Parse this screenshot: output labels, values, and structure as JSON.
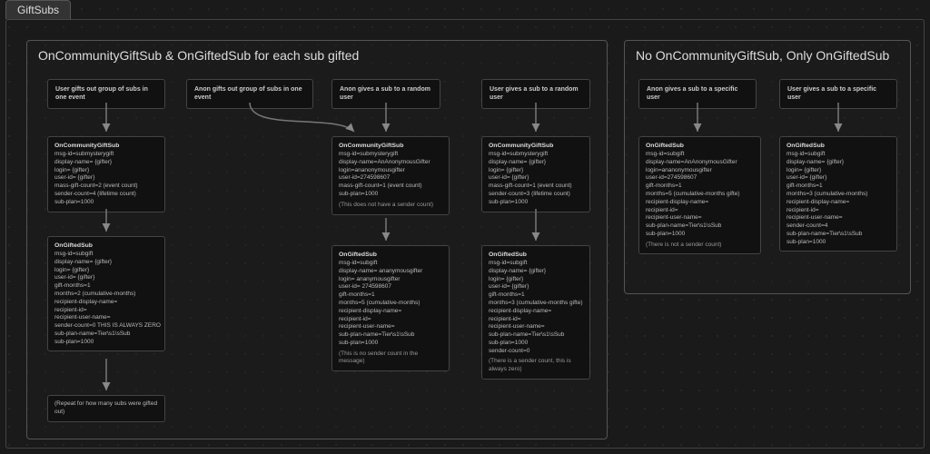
{
  "tab": "GiftSubs",
  "regionA": {
    "title": "OnCommunityGiftSub & OnGiftedSub for each sub gifted",
    "col1": {
      "header": "User gifts out group of subs in one event",
      "community": {
        "title": "OnCommunityGiftSub",
        "lines": [
          "msg-id=submysterygift",
          "display-name= {gifter}",
          "login= {gifter}",
          "user-id= {gifter}",
          "mass-gift-count=2 (event count)",
          "sender-count=4 (lifetime count)",
          "sub-plan=1000"
        ]
      },
      "gifted": {
        "title": "OnGiftedSub",
        "lines": [
          "msg-id=subgift",
          "display-name= {gifter}",
          "login= {gifter}",
          "user-id= {gifter}",
          "gift-months=1",
          "months=2 (cumulative-months)",
          "recipient-display-name=",
          "recipient-id=",
          "recipient-user-name=",
          "sender-count=0 THIS IS ALWAYS ZERO",
          "sub-plan-name=Tier\\s1\\sSub",
          "sub-plan=1000"
        ]
      },
      "repeat": "(Repeat for how many subs were gifted out)"
    },
    "col2": {
      "header": "Anon gifts out group of subs in one event"
    },
    "col3": {
      "header": "Anon gives a sub to a random user",
      "community": {
        "title": "OnCommunityGiftSub",
        "lines": [
          "msg-id=submysterygift",
          "display-name=AnAnonymousGifter",
          "login=ananonymousgifter",
          "user-id=274598607",
          "mass-gift-count=1 (event count)",
          "sub-plan=1000"
        ],
        "note": "(This does not have a sender count)"
      },
      "gifted": {
        "title": "OnGiftedSub",
        "lines": [
          "msg-id=subgift",
          "display-name= ananymousgifter",
          "login= ananymousgifter",
          "user-id= 274598607",
          "gift-months=1",
          "months=5 (cumulative-months)",
          "recipient-display-name=",
          "recipient-id=",
          "recipient-user-name=",
          "sub-plan-name=Tier\\s1\\sSub",
          "sub-plan=1000"
        ],
        "note": "(This is no sender count in the message)"
      }
    },
    "col4": {
      "header": "User gives a sub to a random user",
      "community": {
        "title": "OnCommunityGiftSub",
        "lines": [
          "msg-id=submysterygift",
          "display-name= {gifter}",
          "login= {gifter}",
          "user-id= {gifter}",
          "mass-gift-count=1 (event count)",
          "sender-count=3 (lifetime count)",
          "sub-plan=1000"
        ]
      },
      "gifted": {
        "title": "OnGiftedSub",
        "lines": [
          "msg-id=subgift",
          "display-name= {gifter}",
          "login= {gifter}",
          "user-id= {gifter}",
          "gift-months=1",
          "months=3 (cumulative-months gifte)",
          "recipient-display-name=",
          "recipient-id=",
          "recipient-user-name=",
          "sub-plan-name=Tier\\s1\\sSub",
          "sub-plan=1000",
          "sender-count=0"
        ],
        "note": "(There is a sender count, this is always zero)"
      }
    }
  },
  "regionB": {
    "title": "No OnCommunityGiftSub, Only OnGiftedSub",
    "col1": {
      "header": "Anon gives a sub to a specific user",
      "gifted": {
        "title": "OnGiftedSub",
        "lines": [
          "msg-id=subgift",
          "display-name=AnAnonymousGifter",
          "login=ananonymousgifter",
          "user-id=274598607",
          "gift-months=1",
          "months=5 (cumulative-months gifte)",
          "recipient-display-name=",
          "recipient-id=",
          "recipient-user-name=",
          "sub-plan-name=Tier\\s1\\sSub",
          "sub-plan=1000"
        ],
        "note": "(There is not a sender count)"
      }
    },
    "col2": {
      "header": "User gives a sub to a specific user",
      "gifted": {
        "title": "OnGiftedSub",
        "lines": [
          "msg-id=subgift",
          "display-name= {gifter}",
          "login= {gifter}",
          "user-id= {gifter}",
          "gift-months=1",
          "months=3 (cumulative-months)",
          "recipient-display-name=",
          "recipient-id=",
          "recipient-user-name=",
          "sender-count=4",
          "sub-plan-name=Tier\\s1\\sSub",
          "sub-plan=1000"
        ]
      }
    }
  }
}
